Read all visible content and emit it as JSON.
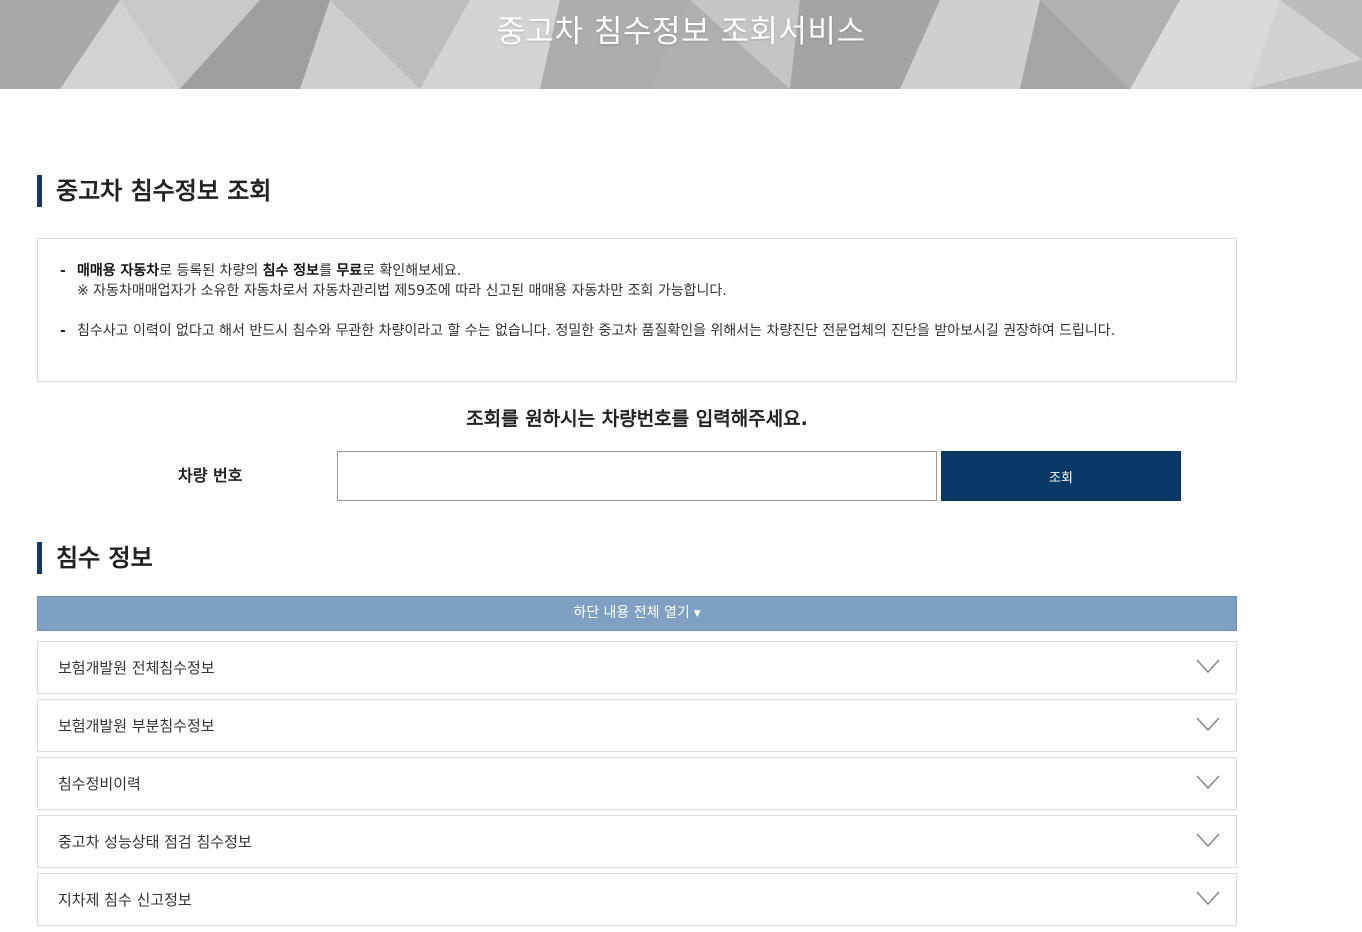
{
  "header": {
    "title": "중고차 침수정보 조회서비스"
  },
  "lookup_section": {
    "title": "중고차 침수정보 조회",
    "notices": [
      {
        "dash": "-",
        "parts": [
          {
            "text": "매매용 자동차",
            "bold": true
          },
          {
            "text": "로 등록된 차량의 ",
            "bold": false
          },
          {
            "text": "침수 정보",
            "bold": true
          },
          {
            "text": "를 ",
            "bold": false
          },
          {
            "text": "무료",
            "bold": true
          },
          {
            "text": "로 확인해보세요.",
            "bold": false
          }
        ],
        "subtext": "※ 자동차매매업자가 소유한 자동차로서 자동차관리법 제59조에 따라 신고된 매매용 자동차만 조회 가능합니다."
      },
      {
        "dash": "-",
        "text": "침수사고 이력이 없다고 해서 반드시 침수와 무관한 차량이라고 할 수는 없습니다. 정밀한 중고차 품질확인을 위해서는 차량진단 전문업체의 진단을 받아보시길 권장하여 드립니다."
      }
    ],
    "prompt": "조회를 원하시는 차량번호를 입력해주세요.",
    "plate_label": "차량 번호",
    "plate_value": "",
    "search_button": "조회"
  },
  "flood_section": {
    "title": "침수 정보",
    "expand_all": "하단 내용 전체 열기",
    "expand_icon": "caret-down-icon",
    "items": [
      {
        "label": "보험개발원 전체침수정보",
        "icon": "chevron-down-icon"
      },
      {
        "label": "보험개발원 부분침수정보",
        "icon": "chevron-down-icon"
      },
      {
        "label": "침수정비이력",
        "icon": "chevron-down-icon"
      },
      {
        "label": "중고차 성능상태 점검 침수정보",
        "icon": "chevron-down-icon"
      },
      {
        "label": "지차제 침수 신고정보",
        "icon": "chevron-down-icon"
      }
    ]
  },
  "colors": {
    "accent": "#0b3967",
    "expand_bar": "#7f9fc3",
    "border": "#dcdcdc"
  }
}
